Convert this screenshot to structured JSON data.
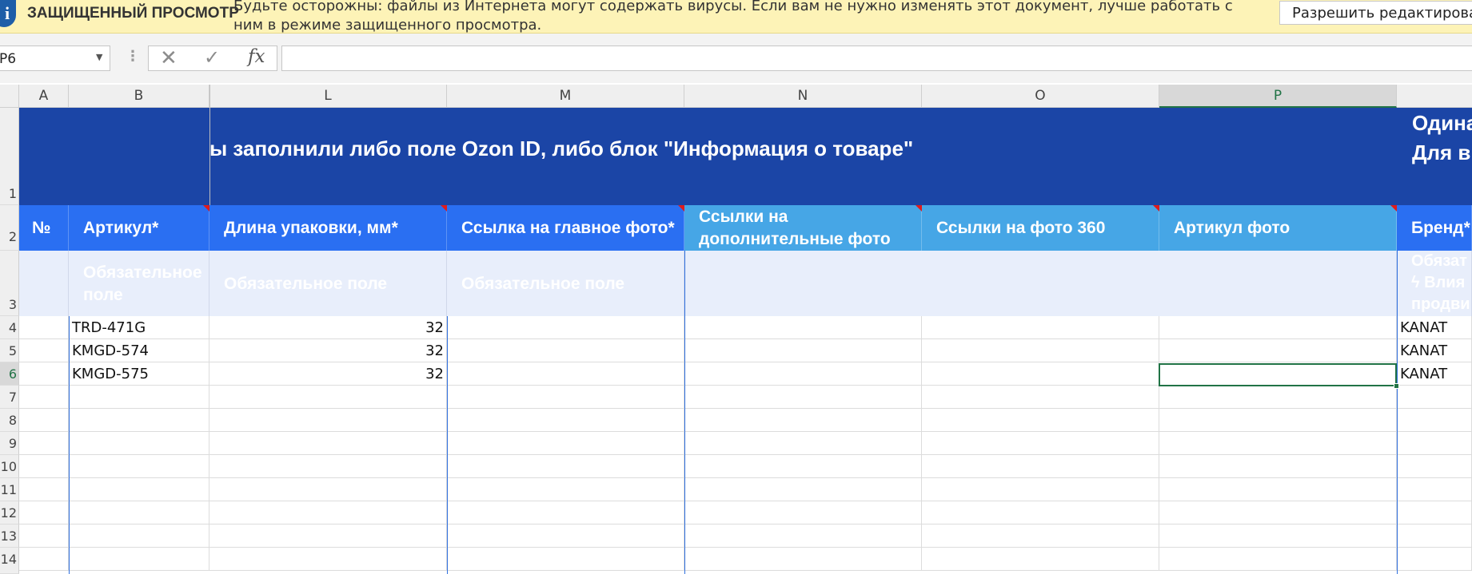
{
  "protected_view": {
    "icon": "info-icon",
    "title": "ЗАЩИЩЕННЫЙ ПРОСМОТР",
    "message": "Будьте осторожны: файлы из Интернета могут содержать вирусы. Если вам не нужно изменять этот документ, лучше работать с ним в режиме защищенного просмотра.",
    "button": "Разрешить редактирование"
  },
  "formula_bar": {
    "name_box": "P6",
    "fx": "fx",
    "value": ""
  },
  "columns": [
    "A",
    "B",
    "L",
    "M",
    "N",
    "O",
    "P"
  ],
  "selected_column": "P",
  "banner": {
    "text": "ы заполнили либо поле Ozon ID, либо блок \"Информация о товаре\"",
    "right_line1": "Одина",
    "right_line2": "Для в"
  },
  "headers": {
    "A": "№",
    "B": "Артикул*",
    "L": "Длина упаковки, мм*",
    "M": "Ссылка на главное фото*",
    "N": "Ссылки на дополнительные фото",
    "O": "Ссылки на фото 360",
    "P": "Артикул фото",
    "Q": "Бренд*"
  },
  "hints": {
    "B": "Обязательное поле",
    "L": "Обязательное поле",
    "M": "Обязательное поле",
    "Q_line1": "Обязат",
    "Q_line2": "ϟ Влия",
    "Q_line3": "продви"
  },
  "row_numbers": [
    "1",
    "2",
    "3",
    "4",
    "5",
    "6",
    "7",
    "8",
    "9",
    "10",
    "11",
    "12",
    "13",
    "14"
  ],
  "selected_row": "6",
  "rows": [
    {
      "article": "TRD-471G",
      "length": "32",
      "brand": "KANAT"
    },
    {
      "article": "KMGD-574",
      "length": "32",
      "brand": "KANAT"
    },
    {
      "article": "KMGD-575",
      "length": "32",
      "brand": "KANAT"
    }
  ],
  "colors": {
    "banner": "#1b45a6",
    "header_required": "#2a6ff2",
    "header_optional": "#46a6e6",
    "hint_row": "#e8eefb",
    "selection": "#217346",
    "protected_bar": "#fdf3b7"
  }
}
